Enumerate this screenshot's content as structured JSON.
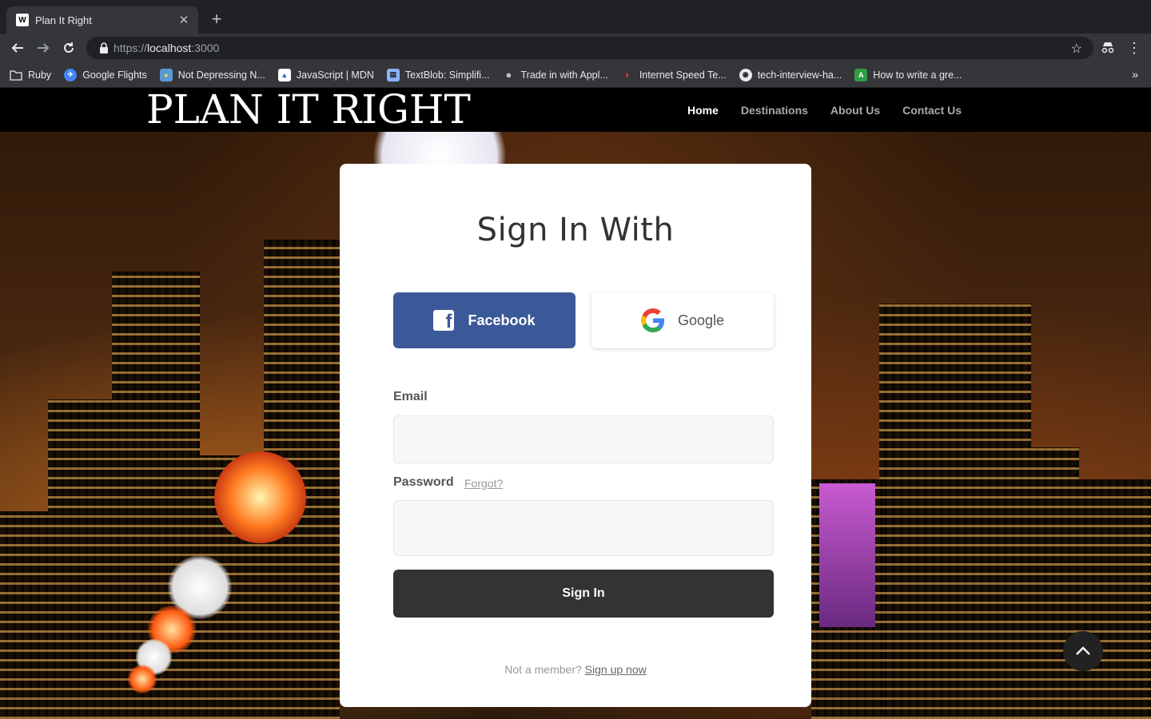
{
  "browser": {
    "tab_title": "Plan It Right",
    "favicon_letter": "W",
    "url_scheme": "https://",
    "url_host": "localhost",
    "url_port": ":3000",
    "bookmarks": [
      {
        "label": "Ruby",
        "icon": "folder-icon"
      },
      {
        "label": "Google Flights",
        "icon": "plane-icon"
      },
      {
        "label": "Not Depressing N...",
        "icon": "sun-icon"
      },
      {
        "label": "JavaScript | MDN",
        "icon": "mdn-icon"
      },
      {
        "label": "TextBlob: Simplifi...",
        "icon": "book-icon"
      },
      {
        "label": "Trade in with Appl...",
        "icon": "apple-icon"
      },
      {
        "label": "Internet Speed Te...",
        "icon": "speedometer-icon"
      },
      {
        "label": "tech-interview-ha...",
        "icon": "github-icon"
      },
      {
        "label": "How to write a gre...",
        "icon": "android-icon"
      }
    ]
  },
  "site": {
    "logo": "PLAN IT RIGHT",
    "nav": [
      "Home",
      "Destinations",
      "About Us",
      "Contact Us"
    ],
    "active_nav": "Home"
  },
  "signin": {
    "title": "Sign In With",
    "facebook_label": "Facebook",
    "google_label": "Google",
    "email_label": "Email",
    "email_value": "",
    "password_label": "Password",
    "password_value": "",
    "forgot_label": "Forgot?",
    "submit_label": "Sign In",
    "footer_text": "Not a member?",
    "signup_label": "Sign up now"
  },
  "colors": {
    "facebook": "#3b5998",
    "submit": "#333333",
    "header": "#000000"
  }
}
